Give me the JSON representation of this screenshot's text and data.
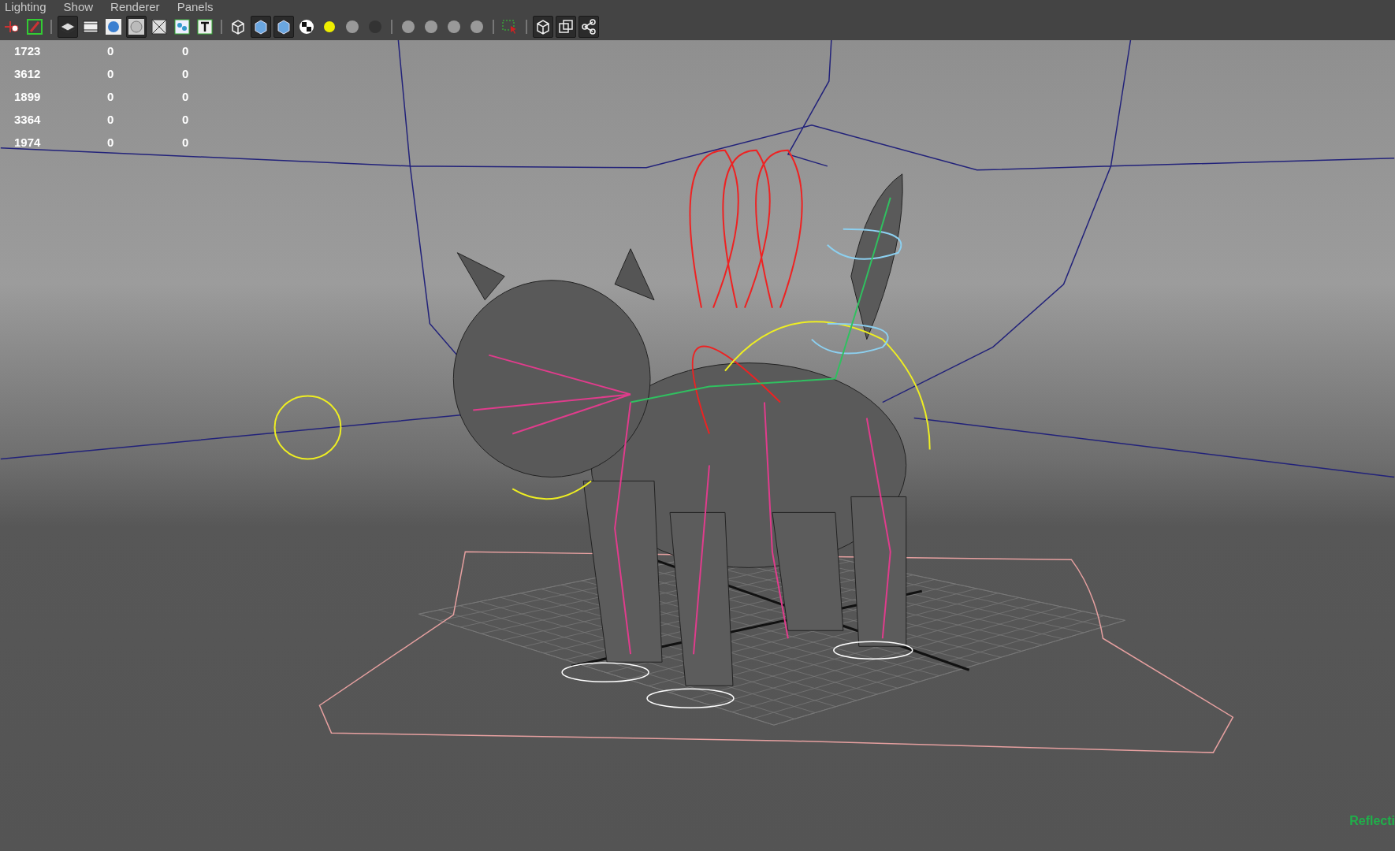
{
  "menu": [
    "Lighting",
    "Show",
    "Renderer",
    "Panels"
  ],
  "toolbar": [
    {
      "kind": "move",
      "selected": false
    },
    {
      "kind": "paint",
      "selected": false
    },
    {
      "kind": "divider"
    },
    {
      "kind": "layers",
      "selected": true
    },
    {
      "kind": "film",
      "selected": false
    },
    {
      "kind": "sphere",
      "selected": false
    },
    {
      "kind": "ring",
      "selected": true
    },
    {
      "kind": "grid",
      "selected": false
    },
    {
      "kind": "dots",
      "selected": false
    },
    {
      "kind": "text",
      "selected": false
    },
    {
      "kind": "divider"
    },
    {
      "kind": "wirecube",
      "selected": false
    },
    {
      "kind": "cube",
      "selected": true
    },
    {
      "kind": "cube",
      "selected": true
    },
    {
      "kind": "checker",
      "selected": false
    },
    {
      "kind": "light",
      "selected": false
    },
    {
      "kind": "ball",
      "selected": false
    },
    {
      "kind": "darkball",
      "selected": false
    },
    {
      "kind": "divider"
    },
    {
      "kind": "ball",
      "selected": false
    },
    {
      "kind": "ball",
      "selected": false
    },
    {
      "kind": "ball",
      "selected": false
    },
    {
      "kind": "ball",
      "selected": false
    },
    {
      "kind": "divider"
    },
    {
      "kind": "select",
      "selected": false
    },
    {
      "kind": "divider"
    },
    {
      "kind": "wirecube",
      "selected": true
    },
    {
      "kind": "squares",
      "selected": true
    },
    {
      "kind": "share",
      "selected": true
    }
  ],
  "hud": [
    [
      "1723",
      "0",
      "0"
    ],
    [
      "3612",
      "0",
      "0"
    ],
    [
      "1899",
      "0",
      "0"
    ],
    [
      "3364",
      "0",
      "0"
    ],
    [
      "1974",
      "0",
      "0"
    ]
  ],
  "corner_label": "Reflecti"
}
